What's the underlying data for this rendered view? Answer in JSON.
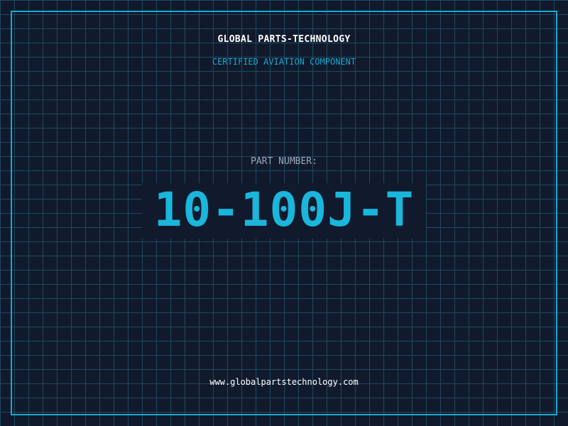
{
  "header": {
    "company": "GLOBAL PARTS-TECHNOLOGY",
    "subtitle": "CERTIFIED AVIATION COMPONENT"
  },
  "part": {
    "label": "PART NUMBER:",
    "number": "10-100J-T"
  },
  "footer": {
    "url": "www.globalpartstechnology.com"
  },
  "colors": {
    "background": "#111a2c",
    "grid": "#1c4a60",
    "accent": "#1aa7cf",
    "part_number": "#1ab6dc"
  }
}
